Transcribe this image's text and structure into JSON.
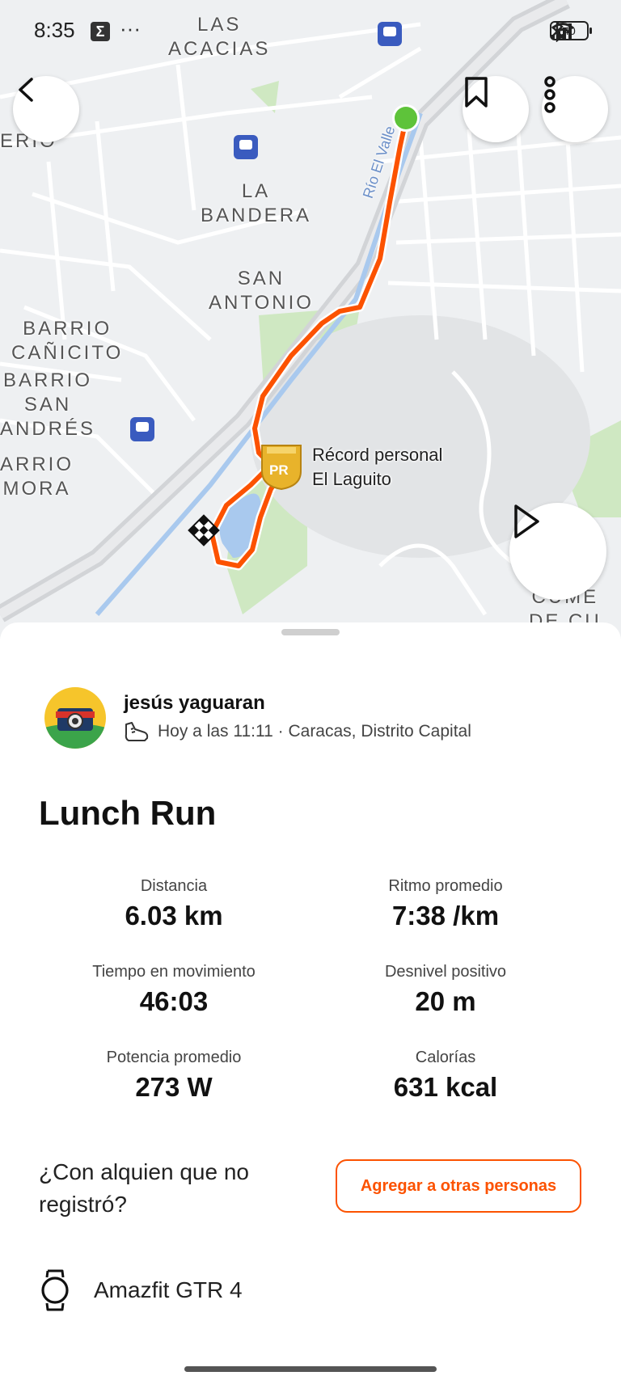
{
  "status_bar": {
    "time": "8:35",
    "battery": "40"
  },
  "map": {
    "labels": [
      {
        "text": "LAS\nACACIAS"
      },
      {
        "text": "LA\nBANDERA"
      },
      {
        "text": "SAN\nANTONIO"
      },
      {
        "text": "BARRIO\nCAÑICITO"
      },
      {
        "text": "BARRIO\nSAN\nANDRÉS"
      },
      {
        "text": "ARRIO\nMORA"
      },
      {
        "text": "ERIO"
      },
      {
        "text": "CUME\nDE CU"
      }
    ],
    "river_label": "Río El Valle",
    "pr_title": "Récord personal",
    "pr_segment": "El Laguito",
    "pr_badge": "PR",
    "route_color": "#fc5200",
    "start_color": "#5ec33a"
  },
  "activity": {
    "athlete": "jesús yaguaran",
    "meta": "Hoy a las 11:11 · Caracas, Distrito Capital",
    "title": "Lunch Run",
    "stats": [
      {
        "label": "Distancia",
        "value": "6.03 km"
      },
      {
        "label": "Ritmo promedio",
        "value": "7:38 /km"
      },
      {
        "label": "Tiempo en movimiento",
        "value": "46:03"
      },
      {
        "label": "Desnivel positivo",
        "value": "20 m"
      },
      {
        "label": "Potencia promedio",
        "value": "273 W"
      },
      {
        "label": "Calorías",
        "value": "631 kcal"
      }
    ],
    "question": "¿Con alquien que no registró?",
    "add_button": "Agregar a otras personas",
    "device": "Amazfit GTR 4"
  },
  "icons": [
    "back-icon",
    "bookmark-icon",
    "more-icon",
    "play-icon",
    "shoe-icon",
    "watch-icon",
    "train-icon",
    "bluetooth-icon",
    "wifi-icon",
    "signal-icon"
  ]
}
